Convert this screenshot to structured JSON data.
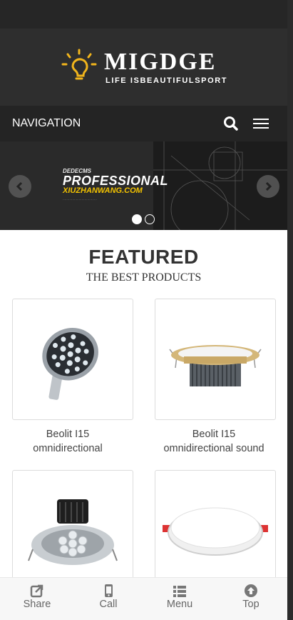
{
  "header": {
    "logo_title": "MIGDGE",
    "logo_subtitle": "LIFE ISBEAUTIFULSPORT",
    "brand_color": "#f2b51c"
  },
  "navbar": {
    "title": "NAVIGATION",
    "search_icon": "search-icon",
    "menu_icon": "hamburger-menu-icon"
  },
  "banner": {
    "small_text": "DEDECMS",
    "big_text": "PROFESSIONAL",
    "url_text": "XIUZHANWANG.COM",
    "slides_total": 2,
    "active_slide": 1
  },
  "featured": {
    "title": "FEATURED",
    "subtitle": "THE BEST PRODUCTS",
    "products": [
      {
        "name_line1": "Beolit I15",
        "name_line2": "omnidirectional"
      },
      {
        "name_line1": "Beolit I15",
        "name_line2": "omnidirectional sound"
      },
      {
        "name_line1": "",
        "name_line2": ""
      },
      {
        "name_line1": "",
        "name_line2": ""
      }
    ]
  },
  "footer": {
    "items": [
      {
        "label": "Share",
        "icon": "share-icon"
      },
      {
        "label": "Call",
        "icon": "phone-icon"
      },
      {
        "label": "Menu",
        "icon": "list-icon"
      },
      {
        "label": "Top",
        "icon": "arrow-up-circle-icon"
      }
    ]
  }
}
